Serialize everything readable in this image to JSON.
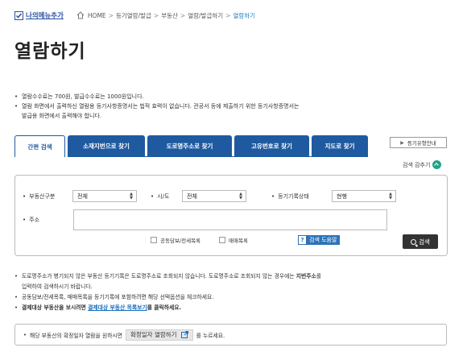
{
  "topbar": {
    "my_menu_label": "나의메뉴추가",
    "breadcrumb": [
      "HOME",
      "등기열람/발급",
      "부동산",
      "열람/발급하기",
      "열람하기"
    ]
  },
  "page_title": "열람하기",
  "notes": [
    "열람수수료는 700원, 발급수수료는 1000원입니다.",
    "열람 화면에서 출력하신 열람용 등기사항증명서는 법적 효력이 없습니다. 관공서 등에 제출하기 위한 등기사항증명서는",
    "발급용 화면에서 출력해야 합니다."
  ],
  "tabs": [
    "간편 검색",
    "소재지번으로 찾기",
    "도로명주소로 찾기",
    "고유번호로 찾기",
    "지도로 찾기"
  ],
  "guide_button": "등기유형안내",
  "collapse_label": "검색 감추기",
  "search": {
    "property_type_label": "부동산구분",
    "property_type_value": "전체",
    "sido_label": "시/도",
    "sido_value": "전체",
    "status_label": "등기기록상태",
    "status_value": "현행",
    "address_label": "주소",
    "address_value": "",
    "opt_collateral": "공동담보/전세목록",
    "opt_sale": "매매목록",
    "help_label": "검색 도움말",
    "search_label": "검색"
  },
  "info": {
    "line1_a": "도로명주소가 병기되지 않은 부동산 등기기록은 도로명주소로 조회되지 않습니다. 도로명주소로 조회되지 않는 경우에는 ",
    "line1_b": "지번주소",
    "line1_c": "를",
    "line2": "입력하여 검색하시기 바랍니다.",
    "line3": "공동담보/전세목록, 매매목록을 등기기록에 포함하려면 해당 선택옵션을 체크하세요.",
    "line4_a": "결제대상 부동산을 보시려면 ",
    "line4_link": "결제대상 부동산 목록보기",
    "line4_b": "를 클릭하세요."
  },
  "bottom": {
    "text_a": "해당 부동산의 확정일자 열람을 원하시면",
    "button": "확정일자 열람하기",
    "text_b": "를 누르세요."
  },
  "colors": {
    "primary": "#1f5aa0",
    "accent": "#22a38a",
    "link": "#1a6fbf"
  }
}
